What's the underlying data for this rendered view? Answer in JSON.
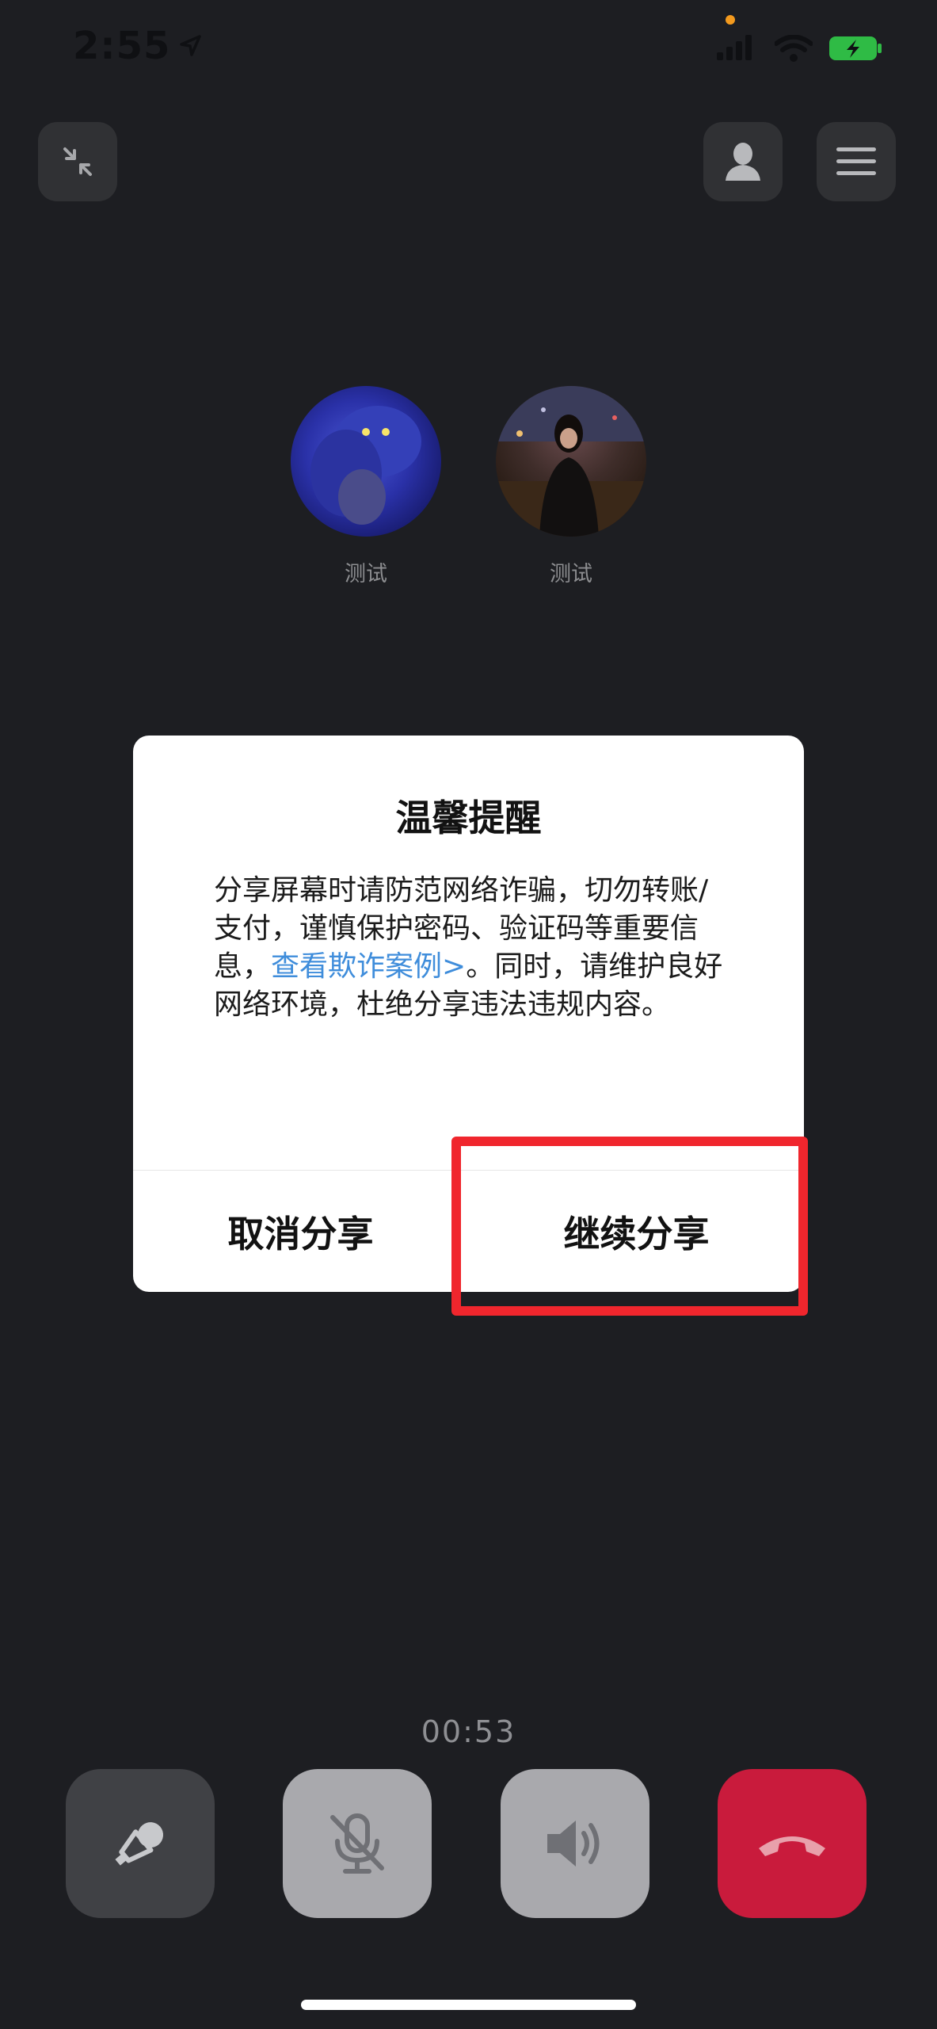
{
  "status_bar": {
    "time": "2:55"
  },
  "participants": [
    {
      "name": "测试"
    },
    {
      "name": "测试"
    }
  ],
  "dialog": {
    "title": "温馨提醒",
    "body_before": "分享屏幕时请防范网络诈骗，切勿转账/支付，谨慎保护密码、验证码等重要信息，",
    "link_text": "查看欺诈案例>",
    "body_after": "。同时，请维护良好网络环境，杜绝分享违法违规内容。",
    "cancel_label": "取消分享",
    "continue_label": "继续分享"
  },
  "call": {
    "timer": "00:53"
  },
  "colors": {
    "background": "#1d1e22",
    "highlight": "#f0262d",
    "link": "#3f8ddb",
    "hangup": "#c91b3c"
  },
  "icons": {
    "minimize": "minimize-icon",
    "contacts": "person-icon",
    "menu": "menu-icon",
    "flip_camera": "flip-camera-icon",
    "mute_mic": "mic-off-icon",
    "speaker": "speaker-icon",
    "hangup": "hangup-phone-icon"
  }
}
